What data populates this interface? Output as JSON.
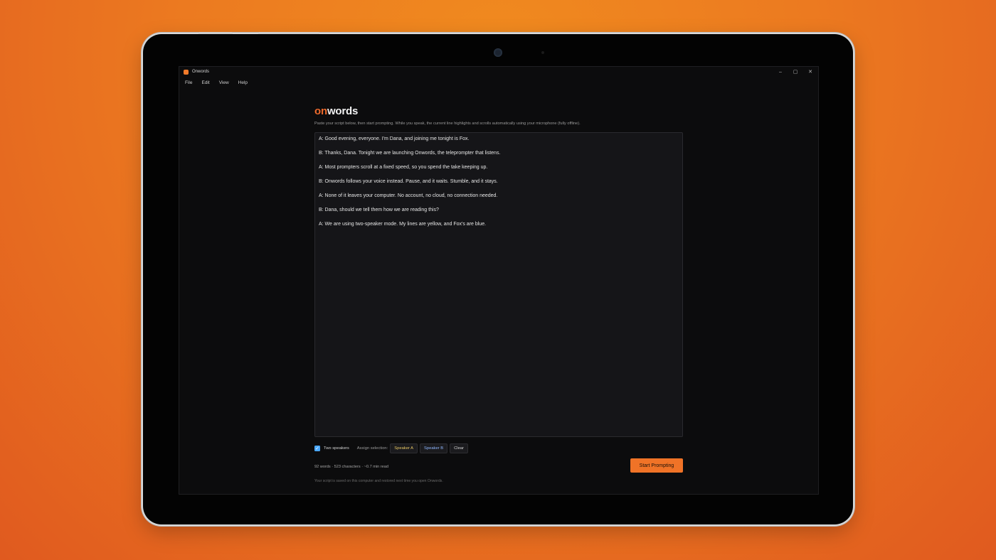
{
  "window": {
    "title": "Onwords",
    "controls": {
      "minimize": "–",
      "maximize": "▢",
      "close": "✕"
    }
  },
  "menu": {
    "items": [
      "File",
      "Edit",
      "View",
      "Help"
    ]
  },
  "header": {
    "logo_on": "on",
    "logo_words": "words",
    "subtitle": "Paste your script below, then start prompting. While you speak, the current line highlights and scrolls automatically using your microphone (fully offline)."
  },
  "script": {
    "lines": [
      "A: Good evening, everyone. I'm Dana, and joining me tonight is Fox.",
      "B: Thanks, Dana. Tonight we are launching Onwords, the teleprompter that listens.",
      "A: Most prompters scroll at a fixed speed, so you spend the take keeping up.",
      "B: Onwords follows your voice instead. Pause, and it waits. Stumble, and it stays.",
      "A: None of it leaves your computer. No account, no cloud, no connection needed.",
      "B: Dana, should we tell them how we are reading this?",
      "A: We are using two-speaker mode. My lines are yellow, and Fox's are blue."
    ]
  },
  "controls": {
    "two_speakers_label": "Two speakers",
    "two_speakers_checked": true,
    "assign_label": "Assign selection:",
    "speaker_a": "Speaker A",
    "speaker_b": "Speaker B",
    "clear": "Clear"
  },
  "stats": {
    "text": "92 words · 523 characters · ~0.7 min read"
  },
  "actions": {
    "start": "Start Prompting"
  },
  "footnote": "Your script is saved on this computer and restored next time you open Onwords.",
  "colors": {
    "accent": "#f07327",
    "speaker_a": "#e8c764",
    "speaker_b": "#8fb7ff",
    "checkbox": "#4aa8ff"
  }
}
